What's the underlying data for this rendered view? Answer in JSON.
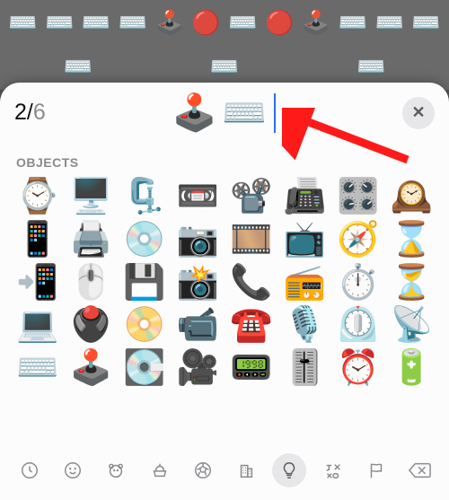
{
  "counter": {
    "current": "2",
    "sep": "/",
    "total": "6"
  },
  "close_label": "✕",
  "input_emojis": [
    "🕹️",
    "⌨️"
  ],
  "section_label": "OBJECTS",
  "background_emojis": [
    "⌨️",
    "⌨️",
    "⌨️",
    "⌨️",
    "🕹️",
    "🔴",
    "⌨️",
    "🔴",
    "🕹️",
    "⌨️",
    "⌨️",
    "⌨️",
    "⌨️",
    "⌨️",
    "⌨️"
  ],
  "grid": [
    "⌚",
    "🖥️",
    "🗜️",
    "📼",
    "📽️",
    "📠",
    "🎛️",
    "🕰️",
    "📱",
    "🖨️",
    "💿",
    "📷",
    "🎞️",
    "📺",
    "🧭",
    "⌛",
    "📲",
    "🖱️",
    "💾",
    "📸",
    "📞",
    "📻",
    "⏱️",
    "⏳",
    "💻",
    "🖲️",
    "📀",
    "📹",
    "☎️",
    "🎙️",
    "⏲️",
    "📡",
    "⌨️",
    "🕹️",
    "💽",
    "🎥",
    "📟",
    "🎚️",
    "⏰",
    "🔋"
  ],
  "categories": [
    {
      "id": "recent",
      "label": "Frequently Used"
    },
    {
      "id": "smileys",
      "label": "Smileys & People"
    },
    {
      "id": "animals",
      "label": "Animals & Nature"
    },
    {
      "id": "food",
      "label": "Food & Drink"
    },
    {
      "id": "activity",
      "label": "Activity"
    },
    {
      "id": "travel",
      "label": "Travel & Places"
    },
    {
      "id": "objects",
      "label": "Objects"
    },
    {
      "id": "symbols",
      "label": "Symbols"
    },
    {
      "id": "flags",
      "label": "Flags"
    }
  ],
  "active_category": "objects",
  "arrow_color": "#ff1a1a"
}
